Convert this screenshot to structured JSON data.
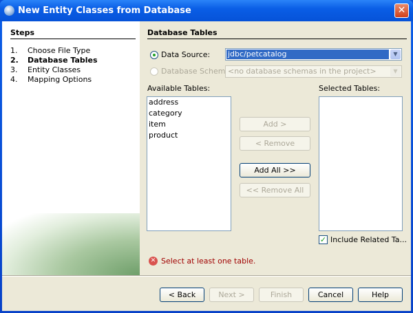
{
  "window": {
    "title": "New Entity Classes from Database"
  },
  "steps": {
    "heading": "Steps",
    "items": [
      {
        "num": "1.",
        "label": "Choose File Type"
      },
      {
        "num": "2.",
        "label": "Database Tables"
      },
      {
        "num": "3.",
        "label": "Entity Classes"
      },
      {
        "num": "4.",
        "label": "Mapping Options"
      }
    ]
  },
  "panel": {
    "heading": "Database Tables",
    "data_source_label": "Data Source:",
    "data_source_value": "jdbc/petcatalog",
    "schema_label": "Database Schema",
    "schema_value": "<no database schemas in the project>",
    "available_label": "Available Tables:",
    "selected_label": "Selected Tables:",
    "available": [
      "address",
      "category",
      "item",
      "product"
    ],
    "add": "Add >",
    "remove": "< Remove",
    "add_all": "Add All >>",
    "remove_all": "<< Remove All",
    "include_related": "Include Related Ta...",
    "error": "Select at least one table."
  },
  "buttons": {
    "back": "< Back",
    "next": "Next >",
    "finish": "Finish",
    "cancel": "Cancel",
    "help": "Help"
  }
}
